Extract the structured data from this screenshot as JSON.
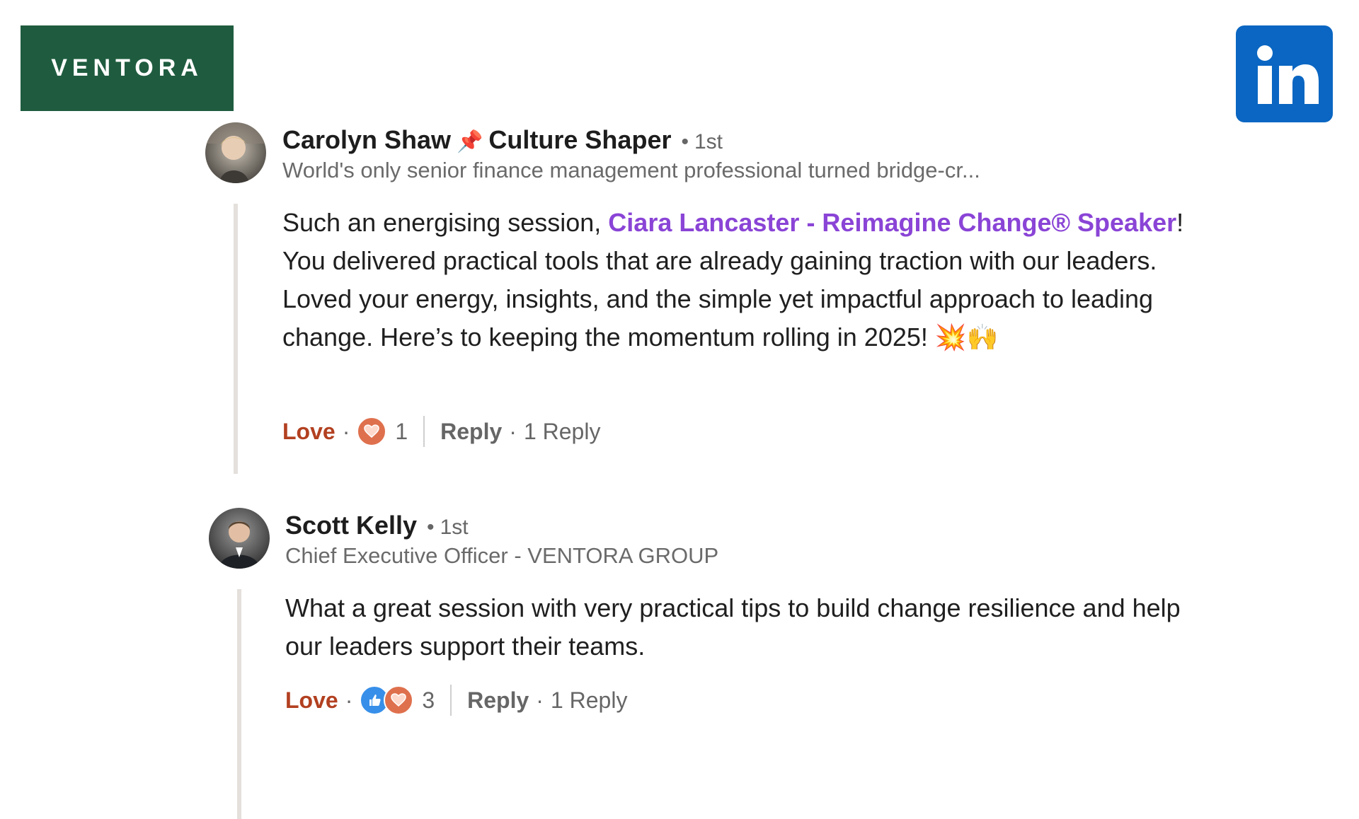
{
  "brand": {
    "logo_text": "VENTORA",
    "logo_color": "#1f5c3f",
    "linkedin_text": "in",
    "linkedin_color": "#0a66c2"
  },
  "comments": [
    {
      "author": "Carolyn Shaw",
      "pin_icon": "pushpin-icon",
      "author_title": "Culture Shaper",
      "degree": "1st",
      "headline": "World's only senior finance management professional turned bridge-cr...",
      "body_before": "Such an energising session, ",
      "mention": "Ciara Lancaster - Reimagine Change® Speaker",
      "body_after": "! You delivered practical tools that are already gaining traction with our leaders. Loved your energy, insights, and the simple yet impactful approach to leading change. Here’s to keeping the momentum rolling in 2025! 💥🙌",
      "reaction_label": "Love",
      "reactions": [
        "love-reaction-icon"
      ],
      "reaction_count": "1",
      "reply_label": "Reply",
      "reply_count": "1 Reply"
    },
    {
      "author": "Scott Kelly",
      "degree": "1st",
      "headline": "Chief Executive Officer - VENTORA GROUP",
      "body": "What a great session with very practical tips to build change resilience and help our leaders support their teams.",
      "reaction_label": "Love",
      "reactions": [
        "like-reaction-icon",
        "love-reaction-icon"
      ],
      "reaction_count": "3",
      "reply_label": "Reply",
      "reply_count": "1 Reply"
    }
  ],
  "colors": {
    "mention": "#8a44d6",
    "love_action": "#b24020",
    "thread_line": "#e4e0dc"
  }
}
